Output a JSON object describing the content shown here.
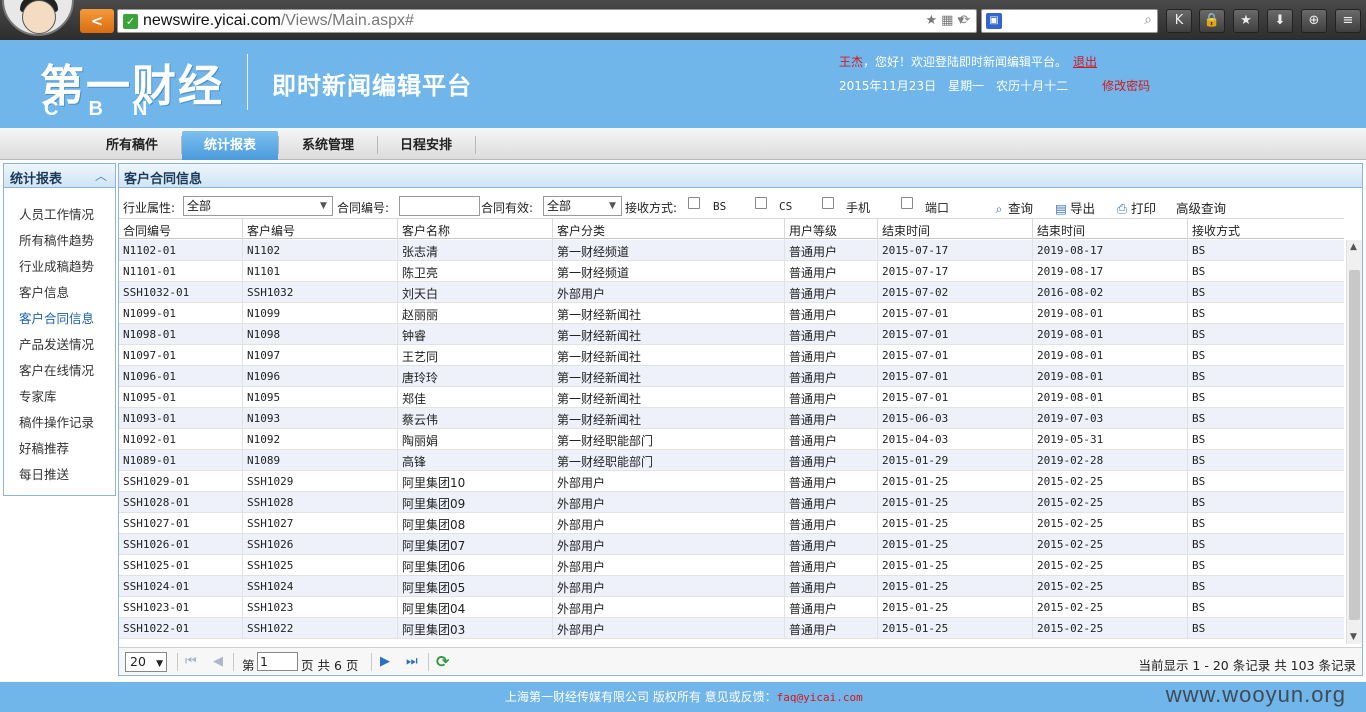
{
  "browser": {
    "back_label": "<",
    "url_host": "newswire.yicai.com",
    "url_path": "/Views/Main.aspx#"
  },
  "header": {
    "logo_text": "第一财经",
    "logo_sub": "CBN",
    "app_title": "即时新闻编辑平台",
    "user_name": "王杰",
    "welcome": "，您好！欢迎登陆即时新闻编辑平台。",
    "logout": "退出",
    "date": "2015年11月23日",
    "weekday": "星期一",
    "lunar": "农历十月十二",
    "change_password": "修改密码"
  },
  "nav": {
    "tabs": [
      "所有稿件",
      "统计报表",
      "系统管理",
      "日程安排"
    ],
    "active_index": 1
  },
  "sidebar": {
    "title": "统计报表",
    "items": [
      "人员工作情况",
      "所有稿件趋势",
      "行业成稿趋势",
      "客户信息",
      "客户合同信息",
      "产品发送情况",
      "客户在线情况",
      "专家库",
      "稿件操作记录",
      "好稿推荐",
      "每日推送"
    ],
    "active_index": 4
  },
  "panel": {
    "title": "客户合同信息"
  },
  "filters": {
    "industry_label": "行业属性:",
    "industry_value": "全部",
    "contract_no_label": "合同编号:",
    "contract_no_value": "",
    "valid_label": "合同有效:",
    "valid_value": "全部",
    "receive_label": "接收方式:",
    "receive_options": [
      "BS",
      "CS",
      "手机",
      "端口"
    ],
    "query": "查询",
    "export": "导出",
    "print": "打印",
    "advanced": "高级查询"
  },
  "table": {
    "columns": [
      "合同编号",
      "客户编号",
      "客户名称",
      "客户分类",
      "用户等级",
      "结束时间",
      "结束时间",
      "接收方式"
    ],
    "rows": [
      [
        "N1102-01",
        "N1102",
        "张志清",
        "第一财经频道",
        "普通用户",
        "2015-07-17",
        "2019-08-17",
        "BS"
      ],
      [
        "N1101-01",
        "N1101",
        "陈卫亮",
        "第一财经频道",
        "普通用户",
        "2015-07-17",
        "2019-08-17",
        "BS"
      ],
      [
        "SSH1032-01",
        "SSH1032",
        "刘天白",
        "外部用户",
        "普通用户",
        "2015-07-02",
        "2016-08-02",
        "BS"
      ],
      [
        "N1099-01",
        "N1099",
        "赵丽丽",
        "第一财经新闻社",
        "普通用户",
        "2015-07-01",
        "2019-08-01",
        "BS"
      ],
      [
        "N1098-01",
        "N1098",
        "钟睿",
        "第一财经新闻社",
        "普通用户",
        "2015-07-01",
        "2019-08-01",
        "BS"
      ],
      [
        "N1097-01",
        "N1097",
        "王艺同",
        "第一财经新闻社",
        "普通用户",
        "2015-07-01",
        "2019-08-01",
        "BS"
      ],
      [
        "N1096-01",
        "N1096",
        "唐玲玲",
        "第一财经新闻社",
        "普通用户",
        "2015-07-01",
        "2019-08-01",
        "BS"
      ],
      [
        "N1095-01",
        "N1095",
        "郑佳",
        "第一财经新闻社",
        "普通用户",
        "2015-07-01",
        "2019-08-01",
        "BS"
      ],
      [
        "N1093-01",
        "N1093",
        "蔡云伟",
        "第一财经新闻社",
        "普通用户",
        "2015-06-03",
        "2019-07-03",
        "BS"
      ],
      [
        "N1092-01",
        "N1092",
        "陶丽娟",
        "第一财经职能部门",
        "普通用户",
        "2015-04-03",
        "2019-05-31",
        "BS"
      ],
      [
        "N1089-01",
        "N1089",
        "高锋",
        "第一财经职能部门",
        "普通用户",
        "2015-01-29",
        "2019-02-28",
        "BS"
      ],
      [
        "SSH1029-01",
        "SSH1029",
        "阿里集团10",
        "外部用户",
        "普通用户",
        "2015-01-25",
        "2015-02-25",
        "BS"
      ],
      [
        "SSH1028-01",
        "SSH1028",
        "阿里集团09",
        "外部用户",
        "普通用户",
        "2015-01-25",
        "2015-02-25",
        "BS"
      ],
      [
        "SSH1027-01",
        "SSH1027",
        "阿里集团08",
        "外部用户",
        "普通用户",
        "2015-01-25",
        "2015-02-25",
        "BS"
      ],
      [
        "SSH1026-01",
        "SSH1026",
        "阿里集团07",
        "外部用户",
        "普通用户",
        "2015-01-25",
        "2015-02-25",
        "BS"
      ],
      [
        "SSH1025-01",
        "SSH1025",
        "阿里集团06",
        "外部用户",
        "普通用户",
        "2015-01-25",
        "2015-02-25",
        "BS"
      ],
      [
        "SSH1024-01",
        "SSH1024",
        "阿里集团05",
        "外部用户",
        "普通用户",
        "2015-01-25",
        "2015-02-25",
        "BS"
      ],
      [
        "SSH1023-01",
        "SSH1023",
        "阿里集团04",
        "外部用户",
        "普通用户",
        "2015-01-25",
        "2015-02-25",
        "BS"
      ],
      [
        "SSH1022-01",
        "SSH1022",
        "阿里集团03",
        "外部用户",
        "普通用户",
        "2015-01-25",
        "2015-02-25",
        "BS"
      ]
    ]
  },
  "pager": {
    "page_size": "20",
    "page_prefix": "第",
    "page_value": "1",
    "page_suffix": "页 共 6 页",
    "summary": "当前显示 1 - 20 条记录 共 103 条记录"
  },
  "footer": {
    "text": "上海第一财经传媒有限公司 版权所有 意见或反馈：",
    "email": "faq@yicai.com",
    "watermark": "www.wooyun.org"
  }
}
